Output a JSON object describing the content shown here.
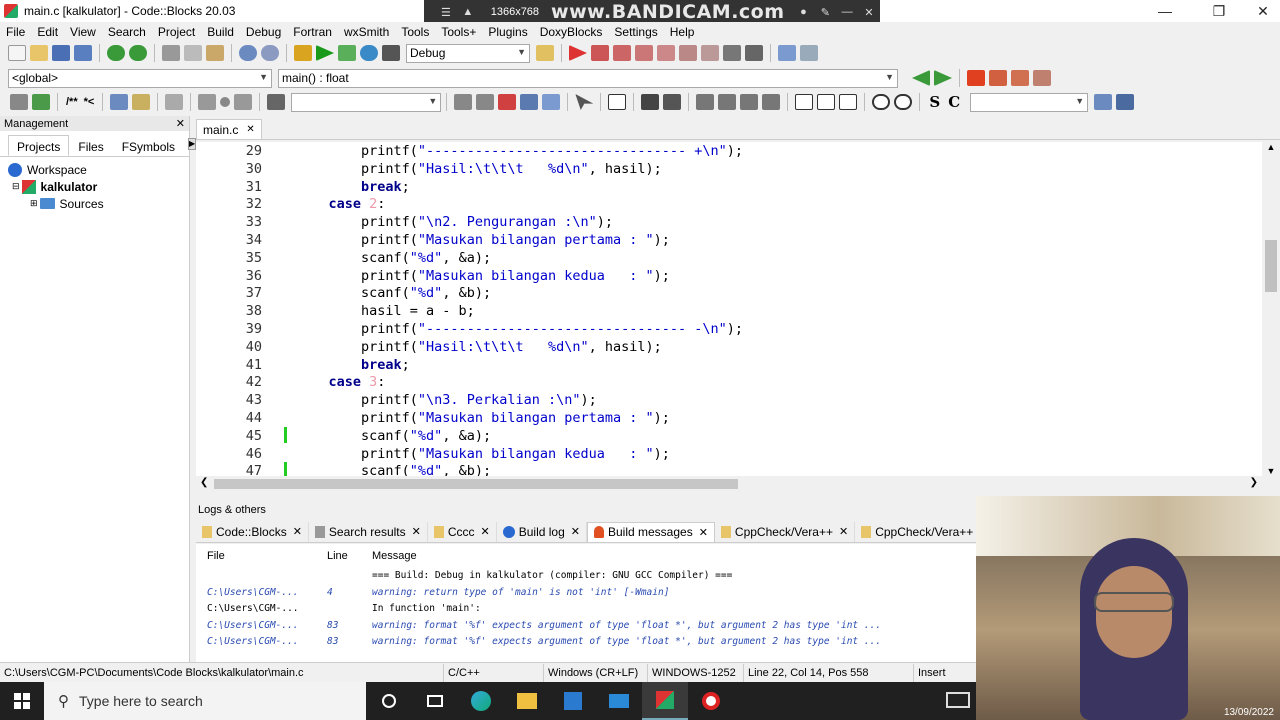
{
  "window": {
    "title": "main.c [kalkulator] - Code::Blocks 20.03"
  },
  "recorder": {
    "resolution": "1366x768",
    "brand": "www.BANDICAM.com"
  },
  "menu": [
    "File",
    "Edit",
    "View",
    "Search",
    "Project",
    "Build",
    "Debug",
    "Fortran",
    "wxSmith",
    "Tools",
    "Tools+",
    "Plugins",
    "DoxyBlocks",
    "Settings",
    "Help"
  ],
  "toolbar": {
    "build_target": "Debug",
    "scope": "<global>",
    "function": "main() : float"
  },
  "management": {
    "title": "Management",
    "tabs": [
      "Projects",
      "Files",
      "FSymbols"
    ],
    "tree": {
      "workspace": "Workspace",
      "project": "kalkulator",
      "folder": "Sources"
    }
  },
  "editor": {
    "tab": "main.c",
    "lines": [
      {
        "n": "29",
        "pre": "        printf(",
        "str": "\"-------------------------------- +\\n\"",
        "post": ");"
      },
      {
        "n": "30",
        "pre": "        printf(",
        "str": "\"Hasil:\\t\\t\\t   %d\\n\"",
        "post": ", hasil);"
      },
      {
        "n": "31",
        "pre": "        ",
        "kw": "break",
        "post": ";"
      },
      {
        "n": "32",
        "pre": "    ",
        "kw": "case",
        "num": " 2",
        "post": ":"
      },
      {
        "n": "33",
        "pre": "        printf(",
        "str": "\"\\n2. Pengurangan :\\n\"",
        "post": ");"
      },
      {
        "n": "34",
        "pre": "        printf(",
        "str": "\"Masukan bilangan pertama : \"",
        "post": ");"
      },
      {
        "n": "35",
        "pre": "        scanf(",
        "str": "\"%d\"",
        "post": ", &a);"
      },
      {
        "n": "36",
        "pre": "        printf(",
        "str": "\"Masukan bilangan kedua   : \"",
        "post": ");"
      },
      {
        "n": "37",
        "pre": "        scanf(",
        "str": "\"%d\"",
        "post": ", &b);"
      },
      {
        "n": "38",
        "pre": "        hasil = a - b;"
      },
      {
        "n": "39",
        "pre": "        printf(",
        "str": "\"-------------------------------- -\\n\"",
        "post": ");"
      },
      {
        "n": "40",
        "pre": "        printf(",
        "str": "\"Hasil:\\t\\t\\t   %d\\n\"",
        "post": ", hasil);"
      },
      {
        "n": "41",
        "pre": "        ",
        "kw": "break",
        "post": ";"
      },
      {
        "n": "42",
        "pre": "    ",
        "kw": "case",
        "num": " 3",
        "post": ":"
      },
      {
        "n": "43",
        "pre": "        printf(",
        "str": "\"\\n3. Perkalian :\\n\"",
        "post": ");"
      },
      {
        "n": "44",
        "pre": "        printf(",
        "str": "\"Masukan bilangan pertama : \"",
        "post": ");"
      },
      {
        "n": "45",
        "pre": "        scanf(",
        "str": "\"%d\"",
        "post": ", &a);"
      },
      {
        "n": "46",
        "pre": "        printf(",
        "str": "\"Masukan bilangan kedua   : \"",
        "post": ");"
      },
      {
        "n": "47",
        "pre": "        scanf(",
        "str": "\"%d\"",
        "post": ", &b);"
      }
    ]
  },
  "logs": {
    "title": "Logs & others",
    "tabs": [
      "Code::Blocks",
      "Search results",
      "Cccc",
      "Build log",
      "Build messages",
      "CppCheck/Vera++",
      "CppCheck/Vera++"
    ],
    "columns": [
      "File",
      "Line",
      "Message"
    ],
    "rows": [
      {
        "file": "",
        "line": "",
        "msg": "=== Build: Debug in kalkulator (compiler: GNU GCC Compiler) ===",
        "kind": "info"
      },
      {
        "file": "C:\\Users\\CGM-...",
        "line": "4",
        "msg": "warning: return type of 'main' is not 'int' [-Wmain]",
        "kind": "warn"
      },
      {
        "file": "C:\\Users\\CGM-...",
        "line": "",
        "msg": "In function 'main':",
        "kind": "info"
      },
      {
        "file": "C:\\Users\\CGM-...",
        "line": "83",
        "msg": "warning: format '%f' expects argument of type 'float *', but argument 2 has type 'int ...",
        "kind": "warn"
      },
      {
        "file": "C:\\Users\\CGM-...",
        "line": "83",
        "msg": "warning: format '%f' expects argument of type 'float *', but argument 2 has type 'int ...",
        "kind": "warn"
      }
    ]
  },
  "status": {
    "path": "C:\\Users\\CGM-PC\\Documents\\Code Blocks\\kalkulator\\main.c",
    "lang": "C/C++",
    "eol": "Windows (CR+LF)",
    "encoding": "WINDOWS-1252",
    "position": "Line 22, Col 14, Pos 558",
    "mode": "Insert"
  },
  "taskbar": {
    "search_placeholder": "Type here to search",
    "date": "13/09/2022"
  }
}
